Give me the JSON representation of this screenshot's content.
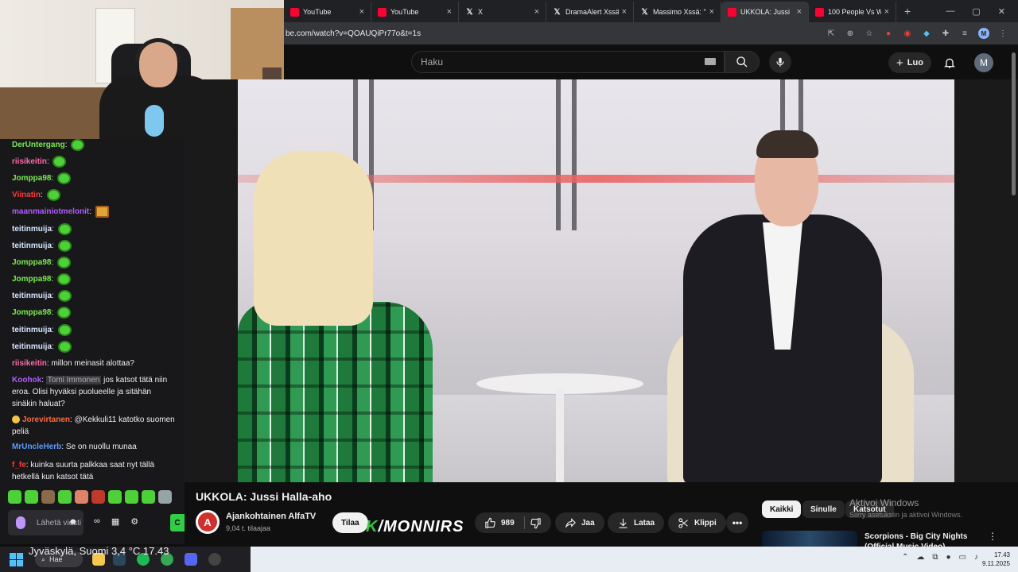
{
  "browser": {
    "tabs": [
      {
        "title": "YouTube",
        "type": "yt"
      },
      {
        "title": "YouTube",
        "type": "yt"
      },
      {
        "title": "X",
        "type": "x"
      },
      {
        "title": "DramaAlert Xssä:",
        "type": "x"
      },
      {
        "title": "Massimo Xssä: \"A",
        "type": "x"
      },
      {
        "title": "UKKOLA: Jussi",
        "type": "yt",
        "active": true
      },
      {
        "title": "100 People Vs W",
        "type": "yt"
      }
    ],
    "url": "be.com/watch?v=QOAUQiPr77o&t=1s"
  },
  "youtube": {
    "search_placeholder": "Haku",
    "create_label": "Luo",
    "avatar_letter": "M",
    "video_title": "UKKOLA: Jussi Halla-aho",
    "channel_name": "Ajankohtainen AlfaTV",
    "channel_logo_letter": "A",
    "channel_subs": "9,04 t. tilaajaa",
    "subscribe_label": "Tilaa",
    "like_count": "989",
    "share_label": "Jaa",
    "download_label": "Lataa",
    "clip_label": "Klippi",
    "chips": [
      "Kaikki",
      "Sinulle",
      "Katsotut"
    ],
    "recommended_title": "Scorpions - Big City Nights (Official Music Video)"
  },
  "windows_activation": {
    "title": "Aktivoi Windows",
    "subtitle": "Siirry asetuksiin ja aktivoi Windows."
  },
  "overlay_logo": {
    "prefix": "K",
    "rest": "/MONNIRS"
  },
  "chat": {
    "messages": [
      {
        "user": "DerUntergang",
        "color": "#7bea4c",
        "text": "",
        "emote": "green"
      },
      {
        "user": "riisikeitin",
        "color": "#ff6aa9",
        "text": "",
        "emote": "green"
      },
      {
        "user": "Jomppa98",
        "color": "#7bea4c",
        "text": "",
        "emote": "green"
      },
      {
        "user": "Viinatin",
        "color": "#ff3b3b",
        "text": "",
        "emote": "green"
      },
      {
        "user": "maanmainiotmelonit",
        "color": "#b05cff",
        "text": "",
        "emote": "fire"
      },
      {
        "user": "teitinmuija",
        "color": "#d7e6ff",
        "text": "",
        "emote": "green"
      },
      {
        "user": "teitinmuija",
        "color": "#d7e6ff",
        "text": "",
        "emote": "green"
      },
      {
        "user": "Jomppa98",
        "color": "#7bea4c",
        "text": "",
        "emote": "green"
      },
      {
        "user": "Jomppa98",
        "color": "#7bea4c",
        "text": "",
        "emote": "green"
      },
      {
        "user": "teitinmuija",
        "color": "#d7e6ff",
        "text": "",
        "emote": "green"
      },
      {
        "user": "Jomppa98",
        "color": "#7bea4c",
        "text": "",
        "emote": "green"
      },
      {
        "user": "teitinmuija",
        "color": "#d7e6ff",
        "text": "",
        "emote": "green"
      },
      {
        "user": "teitinmuija",
        "color": "#d7e6ff",
        "text": "",
        "emote": "green"
      },
      {
        "user": "riisikeitin",
        "color": "#ff6aa9",
        "text": "millon meinasit alottaa?"
      },
      {
        "user": "Koohok",
        "color": "#b05cff",
        "mention": "Tomi Immonen",
        "text": "jos katsot tätä niin eroa. Olisi hyväksi puolueelle ja sitähän sinäkin haluat?"
      },
      {
        "user": "Jorevirtanen",
        "color": "#ff6a3b",
        "badge": true,
        "text": "@Kekkuli11 katotko suomen peliä"
      },
      {
        "user": "MrUncleHerb",
        "color": "#5b9bff",
        "text": "Se on nuollu munaa"
      },
      {
        "user": "f_fe",
        "color": "#ff3b3b",
        "text": "kuinka suurta palkkaa saat nyt tällä hetkellä kun katsot tätä"
      }
    ],
    "input_placeholder": "Lähetä viesti",
    "weather_overlay": "Jyväskylä, Suomi   3,4 °C   17.43"
  },
  "taskbar": {
    "search_label": "Hae",
    "time": "17.43",
    "date": "9.11.2025"
  }
}
